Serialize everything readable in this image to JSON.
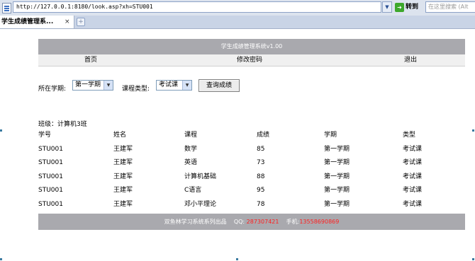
{
  "browser": {
    "url": "http://127.0.0.1:8180/look.asp?xh=STU001",
    "go_label": "转到",
    "search_placeholder": "在这里搜索 (Alt",
    "tab_title": "学生成绩管理系...",
    "tab_close": "×",
    "new_tab": "+"
  },
  "header": {
    "title": "学生成绩管理系统v1.00"
  },
  "nav": {
    "home": "首页",
    "change_password": "修改密码",
    "logout": "退出"
  },
  "filters": {
    "term_label": "所在学期:",
    "term_value": "第一学期",
    "type_label": "课程类型:",
    "type_value": "考试课",
    "query_button": "查询成绩"
  },
  "class_info": "班级：计算机3班",
  "table": {
    "columns": [
      "学号",
      "姓名",
      "课程",
      "成绩",
      "学期",
      "类型"
    ],
    "rows": [
      [
        "STU001",
        "王建军",
        "数学",
        "85",
        "第一学期",
        "考试课"
      ],
      [
        "STU001",
        "王建军",
        "英语",
        "73",
        "第一学期",
        "考试课"
      ],
      [
        "STU001",
        "王建军",
        "计算机基础",
        "88",
        "第一学期",
        "考试课"
      ],
      [
        "STU001",
        "王建军",
        "C语言",
        "95",
        "第一学期",
        "考试课"
      ],
      [
        "STU001",
        "王建军",
        "邓小平理论",
        "78",
        "第一学期",
        "考试课"
      ]
    ]
  },
  "footer": {
    "brand": "双鱼林学习系统系列出品",
    "qq_label": "QQ:",
    "qq": "287307421",
    "phone_label": "手机:",
    "phone": "13558690869"
  }
}
